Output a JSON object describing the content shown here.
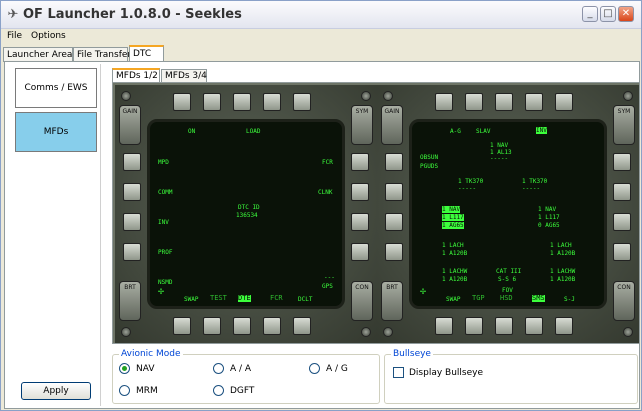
{
  "window": {
    "title": "OF Launcher 1.0.8.0 - Seekles"
  },
  "titlebar_buttons": {
    "minimize": "_",
    "maximize": "□",
    "close": "✕"
  },
  "menu": [
    "File",
    "Options"
  ],
  "tabs": [
    "Launcher Area",
    "File Transfer",
    "DTC"
  ],
  "active_tab": "DTC",
  "nav": [
    "Comms / EWS",
    "MFDs"
  ],
  "nav_selected": "MFDs",
  "apply_label": "Apply",
  "subtabs": [
    "MFDs 1/2",
    "MFDs 3/4"
  ],
  "mfd1": {
    "top": [
      "ON",
      "LOAD"
    ],
    "left": [
      "MPD",
      "COMM",
      "INV",
      "PROF",
      "NSMD"
    ],
    "right": [
      "FCR",
      "CLNK",
      "GPS"
    ],
    "center": [
      "DTC ID",
      "136534"
    ],
    "bottom": [
      "SWAP",
      "TEST",
      "DTE",
      "FCR",
      "DCLT"
    ],
    "right_top_sep": "---"
  },
  "mfd2": {
    "top": [
      "A-G",
      "SLAV",
      "INV"
    ],
    "top_block": [
      "1 NAV",
      "1 AL13",
      "-----"
    ],
    "left_labels": [
      "OBSUN",
      "PGUDS"
    ],
    "stores_left_header": [
      "1 TK370",
      "-----"
    ],
    "stores_right_header": [
      "1 TK370",
      "-----"
    ],
    "sel_block": [
      "1 NAV",
      "1 L117",
      "1 AG65"
    ],
    "right_block": [
      "1 NAV",
      "1 L117",
      "0 AG65"
    ],
    "lower_left": [
      "1 LACH",
      "1 A120B",
      "",
      "1 LACHW",
      "1 A120B"
    ],
    "lower_right": [
      "1 LACH",
      "1 A120B",
      "",
      "1 LACHW",
      "1 A120B"
    ],
    "cat": [
      "CAT III",
      "S-S 6"
    ],
    "fov": "FOV",
    "bottom": [
      "SWAP",
      "TGP",
      "HSD",
      "SMS",
      "S-J"
    ]
  },
  "avionic_mode": {
    "title": "Avionic Mode",
    "options": [
      "NAV",
      "A / A",
      "A / G",
      "MRM",
      "DGFT"
    ],
    "selected": "NAV"
  },
  "bullseye": {
    "title": "Bullseye",
    "label": "Display Bullseye",
    "checked": false
  },
  "colors": {
    "accent": "#f5a623",
    "nav_selected": "#87ceeb",
    "mfd_text": "#3cff3c"
  }
}
